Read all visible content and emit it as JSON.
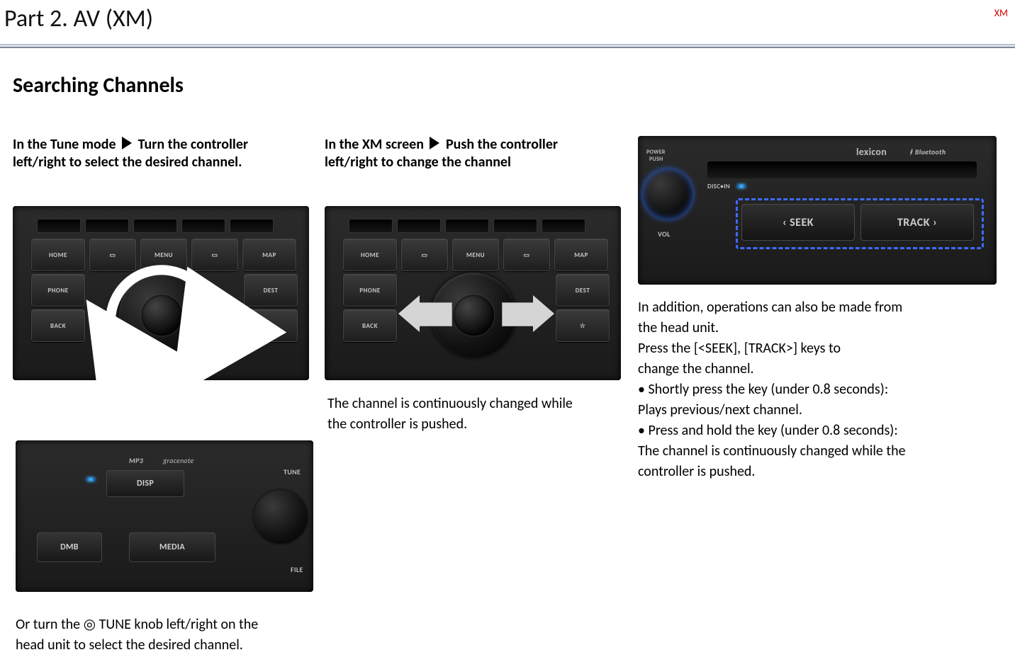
{
  "header": {
    "title": "Part 2. AV (XM)",
    "tag": "XM"
  },
  "section": {
    "heading": "Searching Channels"
  },
  "col1": {
    "line1a": "In the Tune mode ",
    "line1b": " Turn the controller",
    "line2": "left/right to select the desired channel.",
    "note1": "Or turn the ",
    "note_ring": "◎",
    "note2": " TUNE knob left/right on the",
    "note3": "head unit to select the desired channel."
  },
  "col2": {
    "line1a": "In the XM screen ",
    "line1b": " Push the controller",
    "line2": "left/right to change the channel",
    "desc1": "The channel is continuously changed while",
    "desc2": "the controller is pushed."
  },
  "col3": {
    "p1": "In addition, operations can also be made from",
    "p2": "the head unit.",
    "p3": "Press the [<SEEK], [TRACK>] keys to",
    "p4": "change the channel.",
    "p5": "• Shortly press the key (under 0.8 seconds):",
    "p6": "Plays previous/next channel.",
    "p7": "• Press and hold the key (under 0.8 seconds):",
    "p8": "The channel is continuously changed while the",
    "p9": "controller is pushed."
  },
  "controller_buttons": {
    "home": "HOME",
    "menu": "MENU",
    "map": "MAP",
    "phone": "PHONE",
    "dest": "DEST",
    "back": "BACK",
    "star": "☆"
  },
  "head_unit_right": {
    "power": "POWER",
    "push": "PUSH",
    "vol": "VOL",
    "discin": "DISC•IN",
    "brand": "lexicon",
    "bt": "Bluetooth",
    "seek": "‹ SEEK",
    "track": "TRACK ›"
  },
  "head_unit_left": {
    "mp3": "MP3",
    "gn": "gracenote",
    "disp": "DISP",
    "dmb": "DMB",
    "media": "MEDIA",
    "tune": "TUNE",
    "file": "FILE"
  }
}
